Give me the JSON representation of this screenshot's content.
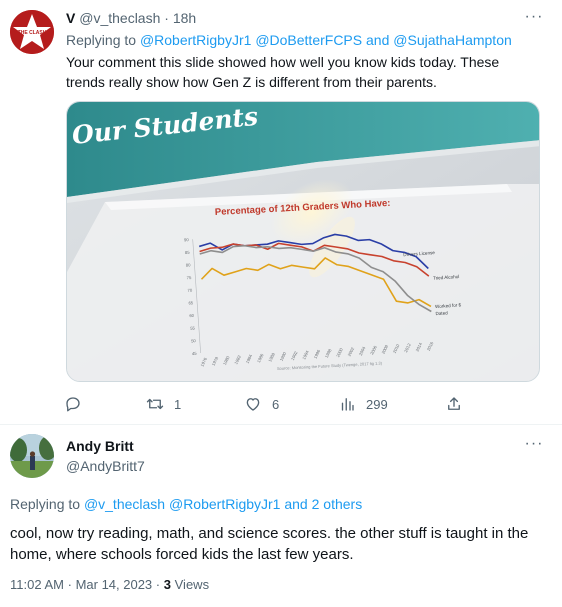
{
  "reply_tweet": {
    "author_name": "V",
    "author_handle": "@v_theclash",
    "separator": "·",
    "time_ago": "18h",
    "avatar_label": "THE CLASH",
    "replying_prefix": "Replying to",
    "replying_to": [
      "@RobertRigbyJr1",
      "@DoBetterFCPS",
      "@SujathaHampton"
    ],
    "replying_and": "and",
    "text": "Your comment this slide showed how well you know kids today. These trends really show how Gen Z is different from their parents.",
    "stats": {
      "replies": "",
      "retweets": "1",
      "likes": "6",
      "views": "299"
    }
  },
  "slide": {
    "heading": "Our Students",
    "chart_data": {
      "type": "line",
      "title": "Percentage of 12th Graders Who Have:",
      "x": [
        1976,
        1978,
        1980,
        1982,
        1984,
        1986,
        1988,
        1990,
        1992,
        1994,
        1996,
        1998,
        2000,
        2002,
        2004,
        2006,
        2008,
        2010,
        2012,
        2014,
        2016
      ],
      "x_tick_labels": [
        "1976",
        "1978",
        "1980",
        "1982",
        "1984",
        "1986",
        "1988",
        "1990",
        "1992",
        "1994",
        "1996",
        "1998",
        "2000",
        "2002",
        "2004",
        "2006",
        "2008",
        "2010",
        "2012",
        "2014",
        "2016"
      ],
      "y_tick_labels": [
        "90",
        "85",
        "80",
        "75",
        "70",
        "65",
        "60",
        "55",
        "50",
        "45"
      ],
      "ylim": [
        45,
        90
      ],
      "series": [
        {
          "name": "Drivers License",
          "color": "#2a3ea6",
          "values": [
            87,
            88,
            85,
            87,
            86,
            86,
            86,
            87,
            86,
            85,
            85,
            87,
            88,
            87,
            85,
            85,
            83,
            80,
            79,
            77,
            72
          ]
        },
        {
          "name": "Tried Alcohol",
          "color": "#c8422e",
          "values": [
            85,
            86,
            86,
            87,
            86,
            86,
            84,
            86,
            85,
            84,
            82,
            84,
            83,
            82,
            80,
            79,
            78,
            76,
            75,
            73,
            69
          ]
        },
        {
          "name": "Worked for $",
          "color": "#e0a21a",
          "values": [
            74,
            78,
            75,
            76,
            77,
            76,
            78,
            76,
            77,
            76,
            75,
            79,
            76,
            75,
            73,
            71,
            69,
            60,
            59,
            60,
            57
          ]
        },
        {
          "name": "Dated",
          "color": "#8e8e8e",
          "values": [
            84,
            85,
            84,
            86,
            86,
            85,
            85,
            84,
            84,
            83,
            82,
            83,
            81,
            80,
            78,
            74,
            72,
            68,
            62,
            58,
            55
          ]
        }
      ],
      "source": "Source: Monitoring the Future Study (Twenge, 2017 fig 1.3)",
      "legend_placement": "right-end-labels"
    }
  },
  "main_tweet": {
    "author_name": "Andy Britt",
    "author_handle": "@AndyBritt7",
    "replying_prefix": "Replying to",
    "replying_to": [
      "@v_theclash",
      "@RobertRigbyJr1"
    ],
    "replying_and": "and",
    "replying_others": "2 others",
    "text": "cool, now try reading, math, and science scores. the other stuff is taught in the home, where schools forced kids the last few years.",
    "time": "11:02 AM",
    "date": "Mar 14, 2023",
    "dot": "·",
    "views_count": "3",
    "views_label": "Views"
  },
  "colors": {
    "link": "#1d9bf0",
    "muted": "#536471",
    "border": "#cfd9de"
  },
  "icons": {
    "more": "more-horizontal-icon",
    "reply": "reply-bubble-icon",
    "retweet": "retweet-arrows-icon",
    "like": "heart-icon",
    "views": "bar-chart-icon",
    "share": "share-upload-icon"
  }
}
